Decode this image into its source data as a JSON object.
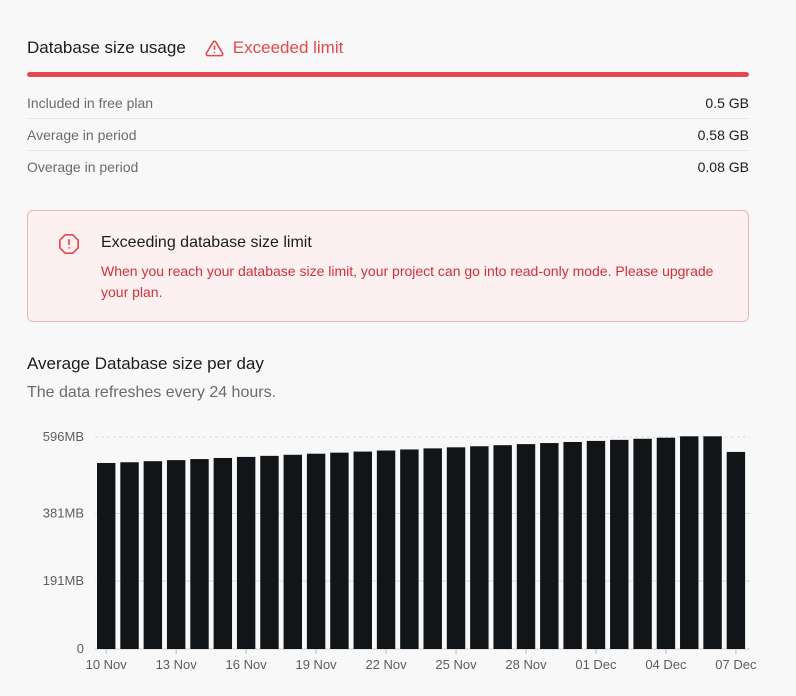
{
  "usage": {
    "title": "Database size usage",
    "status": "Exceeded limit",
    "progress_fraction": 1.0,
    "rows": [
      {
        "label": "Included in free plan",
        "value": "0.5 GB"
      },
      {
        "label": "Average in period",
        "value": "0.58 GB"
      },
      {
        "label": "Overage in period",
        "value": "0.08 GB"
      }
    ]
  },
  "alert": {
    "title": "Exceeding database size limit",
    "body": "When you reach your database size limit, your project can go into read-only mode. Please upgrade your plan."
  },
  "chart_section": {
    "title": "Average Database size per day",
    "subtitle": "The data refreshes every 24 hours."
  },
  "colors": {
    "accent_red": "#e5484d",
    "bar": "#121517"
  },
  "chart_data": {
    "type": "bar",
    "unit": "MB",
    "y_ticks": [
      {
        "value": 0,
        "label": "0"
      },
      {
        "value": 191,
        "label": "191MB"
      },
      {
        "value": 381,
        "label": "381MB"
      },
      {
        "value": 596,
        "label": "596MB"
      }
    ],
    "ylim": [
      0,
      596
    ],
    "limit_line": 596,
    "x_tick_labels": [
      "10 Nov",
      "13 Nov",
      "16 Nov",
      "19 Nov",
      "22 Nov",
      "25 Nov",
      "28 Nov",
      "01 Dec",
      "04 Dec",
      "07 Dec"
    ],
    "categories": [
      "10 Nov",
      "11 Nov",
      "12 Nov",
      "13 Nov",
      "14 Nov",
      "15 Nov",
      "16 Nov",
      "17 Nov",
      "18 Nov",
      "19 Nov",
      "20 Nov",
      "21 Nov",
      "22 Nov",
      "23 Nov",
      "24 Nov",
      "25 Nov",
      "26 Nov",
      "27 Nov",
      "28 Nov",
      "29 Nov",
      "30 Nov",
      "01 Dec",
      "02 Dec",
      "03 Dec",
      "04 Dec",
      "05 Dec",
      "06 Dec",
      "07 Dec"
    ],
    "values": [
      523,
      525,
      528,
      531,
      534,
      537,
      540,
      543,
      546,
      549,
      552,
      555,
      558,
      561,
      564,
      567,
      570,
      573,
      576,
      579,
      582,
      585,
      588,
      591,
      594,
      598,
      598,
      554
    ],
    "grid": true
  }
}
